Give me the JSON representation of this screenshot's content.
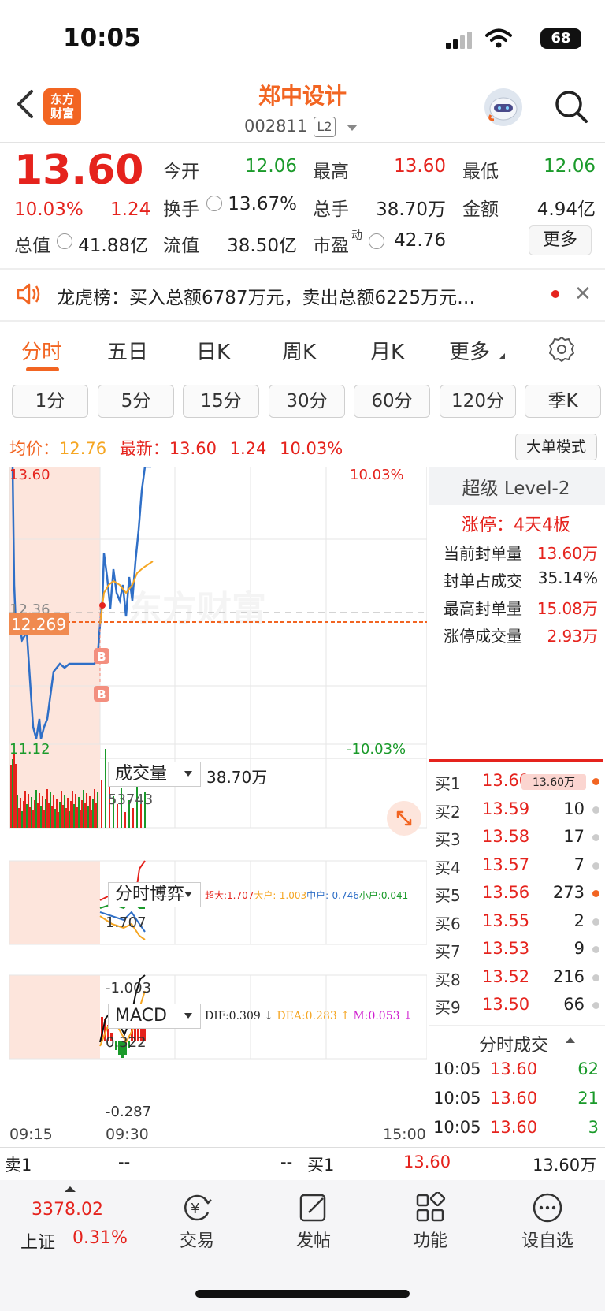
{
  "status": {
    "time": "10:05",
    "battery": "68"
  },
  "header": {
    "logo_line1": "东方",
    "logo_line2": "财富",
    "name": "郑中设计",
    "code": "002811",
    "level": "L2"
  },
  "quote": {
    "price": "13.60",
    "pct": "10.03%",
    "chg": "1.24",
    "open_label": "今开",
    "open": "12.06",
    "high_label": "最高",
    "high": "13.60",
    "low_label": "最低",
    "low": "12.06",
    "turnover_label": "换手",
    "turnover": "13.67%",
    "volume_label": "总手",
    "volume": "38.70万",
    "amount_label": "金额",
    "amount": "4.94亿",
    "mcap_label": "总值",
    "mcap": "41.88亿",
    "float_label": "流值",
    "float": "38.50亿",
    "pe_label": "市盈",
    "pe_sup": "动",
    "pe": "42.76",
    "more": "更多"
  },
  "banner": {
    "text": "龙虎榜：买入总额6787万元，卖出总额6225万元…"
  },
  "tabs": [
    "分时",
    "五日",
    "日K",
    "周K",
    "月K",
    "更多"
  ],
  "periods": [
    "1分",
    "5分",
    "15分",
    "30分",
    "60分",
    "120分",
    "季K"
  ],
  "avg": {
    "avg_label": "均价：",
    "avg": "12.76",
    "last_label": "最新：",
    "last": "13.60",
    "chg": "1.24",
    "pct": "10.03%",
    "mode_btn": "大单模式"
  },
  "chart": {
    "high": "13.60",
    "high_pct": "10.03%",
    "ref": "12.36",
    "cursor_price": "12.269",
    "low": "11.12",
    "low_pct": "-10.03%",
    "watermark": "东方财富",
    "vol_dd": "成交量",
    "vol_total": "38.70万",
    "vol_max": "53743",
    "game_dd": "分时博弈",
    "game_legend": {
      "super": "超大:1.707",
      "big": "大户:-1.003",
      "mid": "中户:-0.746",
      "small": "小户:0.041"
    },
    "game_max": "1.707",
    "game_min": "-1.003",
    "macd_dd": "MACD",
    "macd_legend": {
      "dif": "DIF:0.309 ↓",
      "dea": "DEA:0.283 ↑",
      "m": "M:0.053 ↓"
    },
    "macd_max": "0.322",
    "macd_min": "-0.287",
    "time_start": "09:15",
    "time_mid": "09:30",
    "time_end": "15:00",
    "marker_b": "B",
    "colors": {
      "up": "#e5231d",
      "down": "#1a9a2a",
      "line": "#2f6fc7",
      "avg": "#f5a623",
      "pre_market_bg": "#fde5dc"
    }
  },
  "level2": {
    "title": "超级 Level-2",
    "limit_label": "涨停：",
    "limit_value": "4天4板",
    "rows": [
      {
        "label": "当前封单量",
        "value": "13.60万"
      },
      {
        "label": "封单占成交",
        "value": "35.14%"
      },
      {
        "label": "最高封单量",
        "value": "15.08万"
      },
      {
        "label": "涨停成交量",
        "value": "2.93万"
      }
    ]
  },
  "bids": [
    {
      "label": "买1",
      "price": "13.60",
      "vol": "13.60万",
      "dot": "#f26522"
    },
    {
      "label": "买2",
      "price": "13.59",
      "vol": "10",
      "dot": "#ccc"
    },
    {
      "label": "买3",
      "price": "13.58",
      "vol": "17",
      "dot": "#ccc"
    },
    {
      "label": "买4",
      "price": "13.57",
      "vol": "7",
      "dot": "#ccc"
    },
    {
      "label": "买5",
      "price": "13.56",
      "vol": "273",
      "dot": "#f26522"
    },
    {
      "label": "买6",
      "price": "13.55",
      "vol": "2",
      "dot": "#ccc"
    },
    {
      "label": "买7",
      "price": "13.53",
      "vol": "9",
      "dot": "#ccc"
    },
    {
      "label": "买8",
      "price": "13.52",
      "vol": "216",
      "dot": "#ccc"
    },
    {
      "label": "买9",
      "price": "13.50",
      "vol": "66",
      "dot": "#ccc"
    }
  ],
  "ticks_title": "分时成交",
  "ticks": [
    {
      "time": "10:05",
      "price": "13.60",
      "vol": "62"
    },
    {
      "time": "10:05",
      "price": "13.60",
      "vol": "21"
    },
    {
      "time": "10:05",
      "price": "13.60",
      "vol": "3"
    }
  ],
  "bottom_quote": {
    "sell_label": "卖1",
    "sell_price": "--",
    "sell_vol": "--",
    "buy_label": "买1",
    "buy_price": "13.60",
    "buy_vol": "13.60万"
  },
  "nav": {
    "index_value": "3378.02",
    "index_name": "上证",
    "index_pct": "0.31%",
    "items": [
      "交易",
      "发帖",
      "功能",
      "设自选"
    ]
  }
}
